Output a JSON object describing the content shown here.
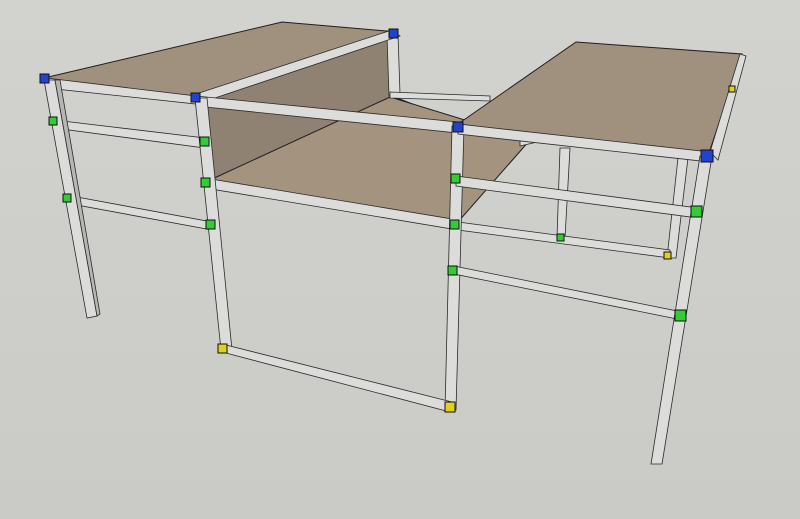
{
  "scene": {
    "background_color": "#cfcfcb",
    "panel_color": "#a0917f",
    "tube_color": "#dcdcda",
    "connector_colors": {
      "corner": "#2244cc",
      "mid": "#33cc33",
      "foot": "#e0d020"
    }
  }
}
